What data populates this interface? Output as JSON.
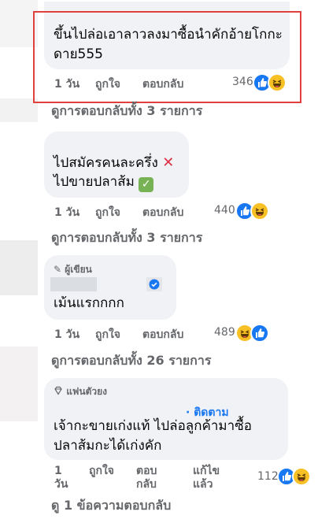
{
  "colors": {
    "bubble": "#f0f2f5",
    "meta_text": "#65676b",
    "highlight_border": "#e0413c",
    "like_blue": "#1877f2",
    "haha_yellow": "#f7c025",
    "verified_blue": "#1877f2"
  },
  "comments": [
    {
      "text": "ขึ้นไปล่อเอาลาวลงมาซื้อนำคักอ้ายโกกะดาย555",
      "time": "1 วัน",
      "like_label": "ถูกใจ",
      "reply_label": "ตอบกลับ",
      "reaction_count": "346",
      "reactions": [
        "like-icon",
        "haha-icon"
      ],
      "highlighted": true,
      "view_replies": "ดูการตอบกลับทั้ง 3 รายการ"
    },
    {
      "text_line1": "ไปสมัครคนละครึ่ง",
      "text_line2": "ไปขายปลาส้ม",
      "line1_emoji": "cross-mark-icon",
      "line2_emoji": "check-mark-icon",
      "time": "1 วัน",
      "like_label": "ถูกใจ",
      "reply_label": "ตอบกลับ",
      "reaction_count": "440",
      "reactions": [
        "like-icon",
        "haha-icon"
      ],
      "view_replies": "ดูการตอบกลับทั้ง 3 รายการ"
    },
    {
      "badge": "ผู้เขียน",
      "badge_icon": "pencil-icon",
      "verified_icon": "verified-badge-icon",
      "text": "เม้นแรกกกก",
      "time": "1 วัน",
      "like_label": "ถูกใจ",
      "reply_label": "ตอบกลับ",
      "reaction_count": "489",
      "reactions": [
        "haha-icon",
        "like-icon"
      ],
      "view_replies": "ดูการตอบกลับทั้ง 26 รายการ"
    },
    {
      "badge": "แฟนตัวยง",
      "badge_icon": "diamond-icon",
      "follow_label": "· ติดตาม",
      "text": "เจ้ากะขายเก่งแท้ ไปล่อลูกค้ามาซื้อ\nปลาส้มกะได้เก่งคัก",
      "time_line1": "1",
      "time_line2": "วัน",
      "like_label": "ถูกใจ",
      "reply_line1": "ตอบ",
      "reply_line2": "กลับ",
      "edited_line1": "แก้ไข",
      "edited_line2": "แล้ว",
      "reaction_count": "112",
      "reactions": [
        "like-icon",
        "haha-icon"
      ],
      "view_replies": "ดู 1 ข้อความตอบกลับ"
    }
  ]
}
